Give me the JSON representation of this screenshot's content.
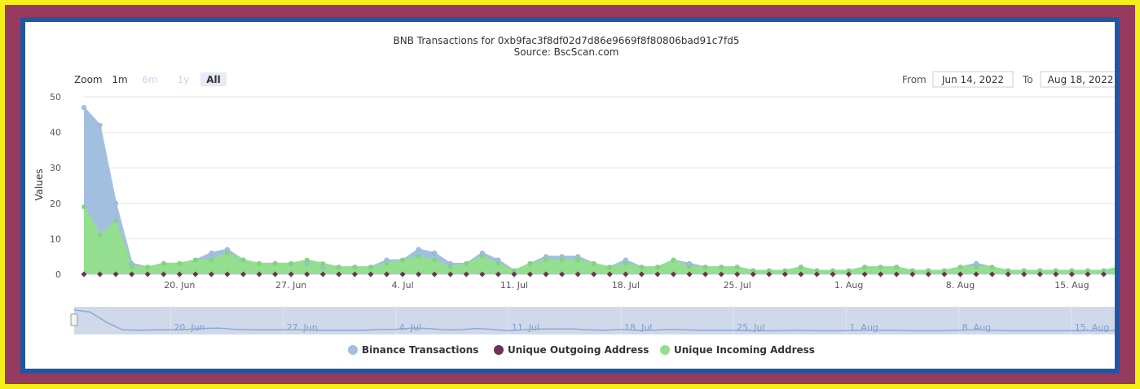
{
  "chart_data": {
    "type": "area",
    "title": "BNB Transactions for 0xb9fac3f8df02d7d86e9669f8f80806bad91c7fd5",
    "subtitle": "Source: BscScan.com",
    "ylabel": "Values",
    "xlabel": "",
    "ylim": [
      0,
      50
    ],
    "yticks": [
      0,
      10,
      20,
      30,
      40,
      50
    ],
    "grid": true,
    "legend_position": "bottom-center",
    "x_dates": [
      "2022-06-14",
      "2022-06-15",
      "2022-06-16",
      "2022-06-17",
      "2022-06-18",
      "2022-06-19",
      "2022-06-20",
      "2022-06-21",
      "2022-06-22",
      "2022-06-23",
      "2022-06-24",
      "2022-06-25",
      "2022-06-26",
      "2022-06-27",
      "2022-06-28",
      "2022-06-29",
      "2022-06-30",
      "2022-07-01",
      "2022-07-02",
      "2022-07-03",
      "2022-07-04",
      "2022-07-05",
      "2022-07-06",
      "2022-07-07",
      "2022-07-08",
      "2022-07-09",
      "2022-07-10",
      "2022-07-11",
      "2022-07-12",
      "2022-07-13",
      "2022-07-14",
      "2022-07-15",
      "2022-07-16",
      "2022-07-17",
      "2022-07-18",
      "2022-07-19",
      "2022-07-20",
      "2022-07-21",
      "2022-07-22",
      "2022-07-23",
      "2022-07-24",
      "2022-07-25",
      "2022-07-26",
      "2022-07-27",
      "2022-07-28",
      "2022-07-29",
      "2022-07-30",
      "2022-07-31",
      "2022-08-01",
      "2022-08-02",
      "2022-08-03",
      "2022-08-04",
      "2022-08-05",
      "2022-08-06",
      "2022-08-07",
      "2022-08-08",
      "2022-08-09",
      "2022-08-10",
      "2022-08-11",
      "2022-08-12",
      "2022-08-13",
      "2022-08-14",
      "2022-08-15",
      "2022-08-16",
      "2022-08-17",
      "2022-08-18"
    ],
    "x_tick_labels": [
      {
        "date": "2022-06-20",
        "label": "20. Jun"
      },
      {
        "date": "2022-06-27",
        "label": "27. Jun"
      },
      {
        "date": "2022-07-04",
        "label": "4. Jul"
      },
      {
        "date": "2022-07-11",
        "label": "11. Jul"
      },
      {
        "date": "2022-07-18",
        "label": "18. Jul"
      },
      {
        "date": "2022-07-25",
        "label": "25. Jul"
      },
      {
        "date": "2022-08-01",
        "label": "1. Aug"
      },
      {
        "date": "2022-08-08",
        "label": "8. Aug"
      },
      {
        "date": "2022-08-15",
        "label": "15. Aug"
      }
    ],
    "series": [
      {
        "name": "Binance Transactions",
        "color": "#a3bfdf",
        "values": [
          47,
          42,
          20,
          3,
          2,
          3,
          3,
          4,
          6,
          7,
          4,
          3,
          3,
          3,
          3,
          2,
          2,
          2,
          2,
          4,
          4,
          7,
          6,
          3,
          3,
          6,
          4,
          1,
          3,
          5,
          5,
          5,
          3,
          2,
          4,
          2,
          2,
          4,
          3,
          2,
          2,
          2,
          1,
          1,
          1,
          2,
          1,
          1,
          1,
          2,
          2,
          2,
          1,
          1,
          1,
          2,
          3,
          2,
          1,
          1,
          1,
          1,
          1,
          1,
          1,
          2
        ]
      },
      {
        "name": "Unique Outgoing Address",
        "color": "#6b3354",
        "values": [
          0,
          0,
          0,
          0,
          0,
          0,
          0,
          0,
          0,
          0,
          0,
          0,
          0,
          0,
          0,
          0,
          0,
          0,
          0,
          0,
          0,
          0,
          0,
          0,
          0,
          0,
          0,
          0,
          0,
          0,
          0,
          0,
          0,
          0,
          0,
          0,
          0,
          0,
          0,
          0,
          0,
          0,
          0,
          0,
          0,
          0,
          0,
          0,
          0,
          0,
          0,
          0,
          0,
          0,
          0,
          0,
          0,
          0,
          0,
          0,
          0,
          0,
          0,
          0,
          0,
          0
        ]
      },
      {
        "name": "Unique Incoming Address",
        "color": "#93df8f",
        "values": [
          19,
          11,
          15,
          2,
          2,
          3,
          3,
          4,
          4,
          6,
          4,
          3,
          3,
          3,
          4,
          3,
          2,
          2,
          2,
          3,
          4,
          5,
          4,
          2,
          3,
          5,
          3,
          1,
          3,
          4,
          4,
          4,
          3,
          2,
          3,
          2,
          2,
          4,
          2,
          2,
          2,
          2,
          1,
          1,
          1,
          2,
          1,
          1,
          1,
          2,
          2,
          2,
          1,
          1,
          1,
          2,
          2,
          2,
          1,
          1,
          1,
          1,
          1,
          1,
          1,
          2
        ]
      }
    ]
  },
  "zoom": {
    "label": "Zoom",
    "buttons": [
      "1m",
      "6m",
      "1y",
      "All"
    ],
    "active": "All"
  },
  "range": {
    "from_label": "From",
    "from_value": "Jun 14, 2022",
    "to_label": "To",
    "to_value": "Aug 18, 2022"
  },
  "colors": {
    "frame_yellow": "#f6ef16",
    "frame_maroon": "#973a5f",
    "frame_blue": "#1f57a5",
    "title": "#333333",
    "navigator_fill": "#cfd9ea",
    "navigator_line": "#8fa9d3"
  }
}
